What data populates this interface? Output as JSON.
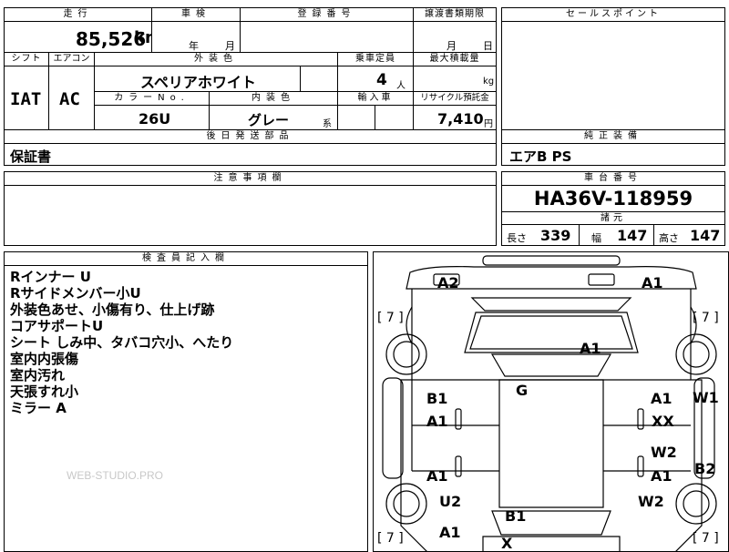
{
  "top": {
    "mileage_label": "走行",
    "mileage_value": "85,526",
    "mileage_unit": "km",
    "shaken_label": "車検",
    "shaken_year": "年",
    "shaken_month": "月",
    "reg_label": "登録番号",
    "transfer_label": "譲渡書類期限",
    "transfer_month": "月",
    "transfer_day": "日",
    "sales_label": "セールスポイント"
  },
  "row2": {
    "shift_label": "シフト",
    "ac_label": "エアコン",
    "color_label": "外装色",
    "color_value": "スペリアホワイト",
    "capacity_label": "乗車定員",
    "capacity_value": "4",
    "capacity_unit": "人",
    "load_label": "最大積載量",
    "load_unit": "kg",
    "shift_value": "IAT",
    "ac_value": "AC",
    "color_no_label": "カラーNo.",
    "color_no_value": "26U",
    "interior_label": "内装色",
    "interior_value": "グレー",
    "interior_suffix": "系",
    "import_label": "輸入車",
    "recycle_label": "リサイクル預託金",
    "recycle_value": "7,410",
    "recycle_unit": "円"
  },
  "parts": {
    "label": "後日発送部品",
    "value": "保証書",
    "equip_label": "純正装備",
    "equip_value": "エアB PS"
  },
  "notes": {
    "label": "注意事項欄"
  },
  "chassis": {
    "label": "車台番号",
    "value": "HA36V-118959",
    "spec_label": "諸元",
    "length_label": "長さ",
    "length_value": "339",
    "width_label": "幅",
    "width_value": "147",
    "height_label": "高さ",
    "height_value": "147"
  },
  "inspector": {
    "label": "検査員記入欄",
    "lines": [
      "Rインナー U",
      "Rサイドメンバー小U",
      "外装色あせ、小傷有り、仕上げ跡",
      "コアサポートU",
      "シート しみ中、タバコ穴小、へたり",
      "室内内張傷",
      "室内汚れ",
      "天張すれ小",
      "ミラー A"
    ]
  },
  "watermark": "WEB-STUDIO.PRO",
  "diagram": {
    "tire_fl": "[ 7 ]",
    "tire_fr": "[ 7 ]",
    "tire_rl": "[ 7 ]",
    "tire_rr": "[ 7 ]",
    "marks": {
      "front_left": "A2",
      "front_right": "A1",
      "hood": "A1",
      "roof": "G",
      "left_front_door_top": "B1",
      "left_front_door_bottom": "A1",
      "right_front_door_top": "A1",
      "right_front_door_bottom": "XX",
      "right_pillar": "W1",
      "left_rear_door": "A1",
      "right_rear_door_top": "W2",
      "right_rear_door_bottom": "A1",
      "right_rear_side": "B2",
      "left_rear_fender": "U2",
      "right_rear_fender": "W2",
      "rear": "B1",
      "left_rear_bottom": "A1",
      "rear_bottom": "X"
    }
  }
}
